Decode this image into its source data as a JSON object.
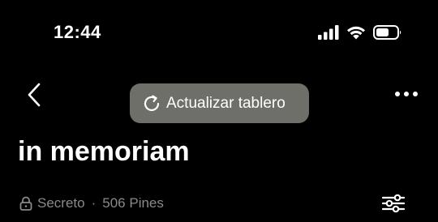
{
  "status_bar": {
    "time": "12:44",
    "icons": [
      "cellular-signal-icon",
      "wifi-icon",
      "battery-icon"
    ]
  },
  "navigation": {
    "back_icon": "chevron-left-icon",
    "more_icon": "more-horizontal-icon"
  },
  "refresh_pill": {
    "icon": "refresh-icon",
    "label": "Actualizar tablero",
    "background": "#6f6f6a"
  },
  "board": {
    "title": "in memoriam",
    "privacy_icon": "lock-icon",
    "privacy_label": "Secreto",
    "separator": "·",
    "pin_count": "506 Pines",
    "filter_icon": "sliders-icon"
  },
  "colors": {
    "background": "#000000",
    "text": "#ffffff",
    "muted_text": "#8a8a8a"
  }
}
